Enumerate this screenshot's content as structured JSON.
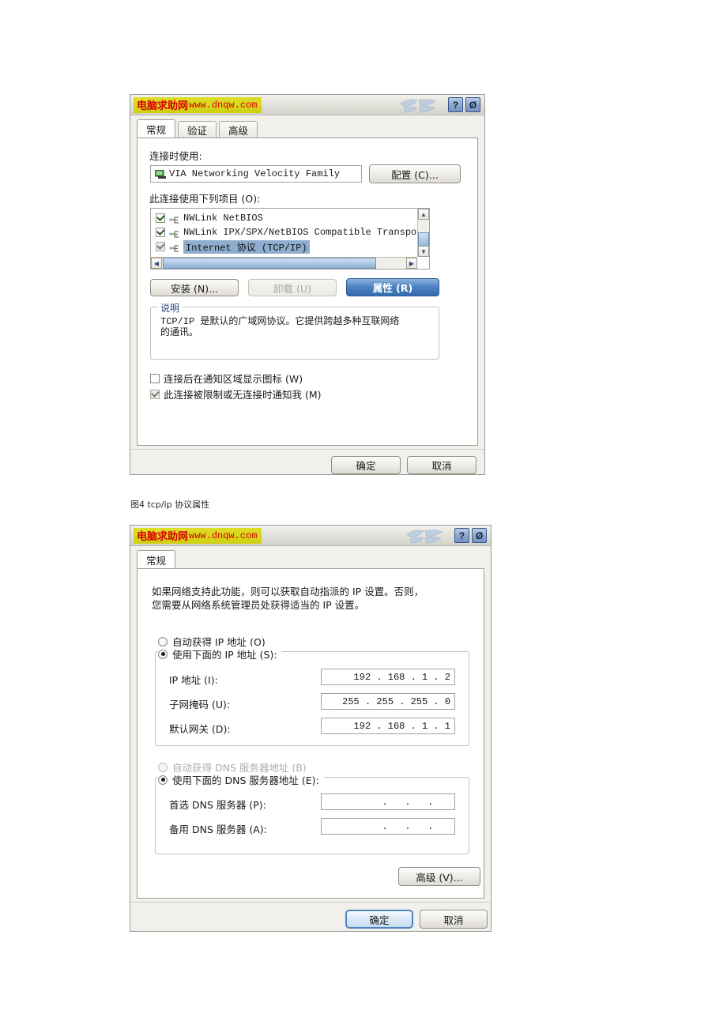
{
  "dialog1": {
    "titlebar": {
      "brand_cn": "电脑求助网",
      "brand_url": "www.dnqw.com",
      "help_button": "?",
      "close_button": "Ø"
    },
    "tabs": [
      {
        "label": "常规",
        "active": true
      },
      {
        "label": "验证",
        "active": false
      },
      {
        "label": "高级",
        "active": false
      }
    ],
    "connect_using_label": "连接时使用:",
    "adapter_name": "VIA Networking Velocity Family",
    "configure_button": "配置 (C)...",
    "items_label": "此连接使用下列项目 (O):",
    "items": [
      {
        "label": "NWLink NetBIOS",
        "checked": true,
        "selected": false
      },
      {
        "label": "NWLink IPX/SPX/NetBIOS Compatible Transpor.",
        "checked": true,
        "selected": false
      },
      {
        "label": "Internet 协议 (TCP/IP)",
        "checked": true,
        "selected": true
      }
    ],
    "install_button": "安装 (N)...",
    "uninstall_button": "卸载 (U)",
    "properties_button": "属性 (R)",
    "description_group_title": "说明",
    "description_line1": "TCP/IP 是默认的广域网协议。它提供跨越多种互联网络",
    "description_line2": "的通讯。",
    "checkbox_tray": {
      "label": "连接后在通知区域显示图标 (W)",
      "checked": false
    },
    "checkbox_notify": {
      "label": "此连接被限制或无连接时通知我 (M)",
      "checked": true
    },
    "ok_button": "确定",
    "cancel_button": "取消"
  },
  "figure_caption": "图4 tcp/ip 协议属性",
  "dialog2": {
    "titlebar": {
      "brand_cn": "电脑求助网",
      "brand_url": "www.dnqw.com",
      "help_button": "?",
      "close_button": "Ø"
    },
    "tabs": [
      {
        "label": "常规",
        "active": true
      }
    ],
    "intro_line1": "如果网络支持此功能，则可以获取自动指派的 IP 设置。否则，",
    "intro_line2": "您需要从网络系统管理员处获得适当的 IP 设置。",
    "ip_auto_radio": {
      "label": "自动获得 IP 地址 (O)",
      "selected": false
    },
    "ip_manual_radio": {
      "label": "使用下面的 IP 地址 (S):",
      "selected": true
    },
    "ip_fields": [
      {
        "label": "IP 地址 (I):",
        "octets": [
          "192",
          "168",
          "1",
          "2"
        ]
      },
      {
        "label": "子网掩码 (U):",
        "octets": [
          "255",
          "255",
          "255",
          "0"
        ]
      },
      {
        "label": "默认网关 (D):",
        "octets": [
          "192",
          "168",
          "1",
          "1"
        ]
      }
    ],
    "dns_auto_radio": {
      "label": "自动获得 DNS 服务器地址 (B)",
      "selected": false,
      "disabled": true
    },
    "dns_manual_radio": {
      "label": "使用下面的 DNS 服务器地址 (E):",
      "selected": true
    },
    "dns_fields": [
      {
        "label": "首选 DNS 服务器 (P):",
        "octets": [
          "",
          "",
          "",
          ""
        ]
      },
      {
        "label": "备用 DNS 服务器 (A):",
        "octets": [
          "",
          "",
          "",
          ""
        ]
      }
    ],
    "advanced_button": "高级 (V)...",
    "ok_button": "确定",
    "cancel_button": "取消"
  },
  "colors": {
    "brand_text": "#d80000",
    "brand_band": "#d5d520",
    "selection": "#8fadcf",
    "accent_blue": "#336cb0"
  }
}
